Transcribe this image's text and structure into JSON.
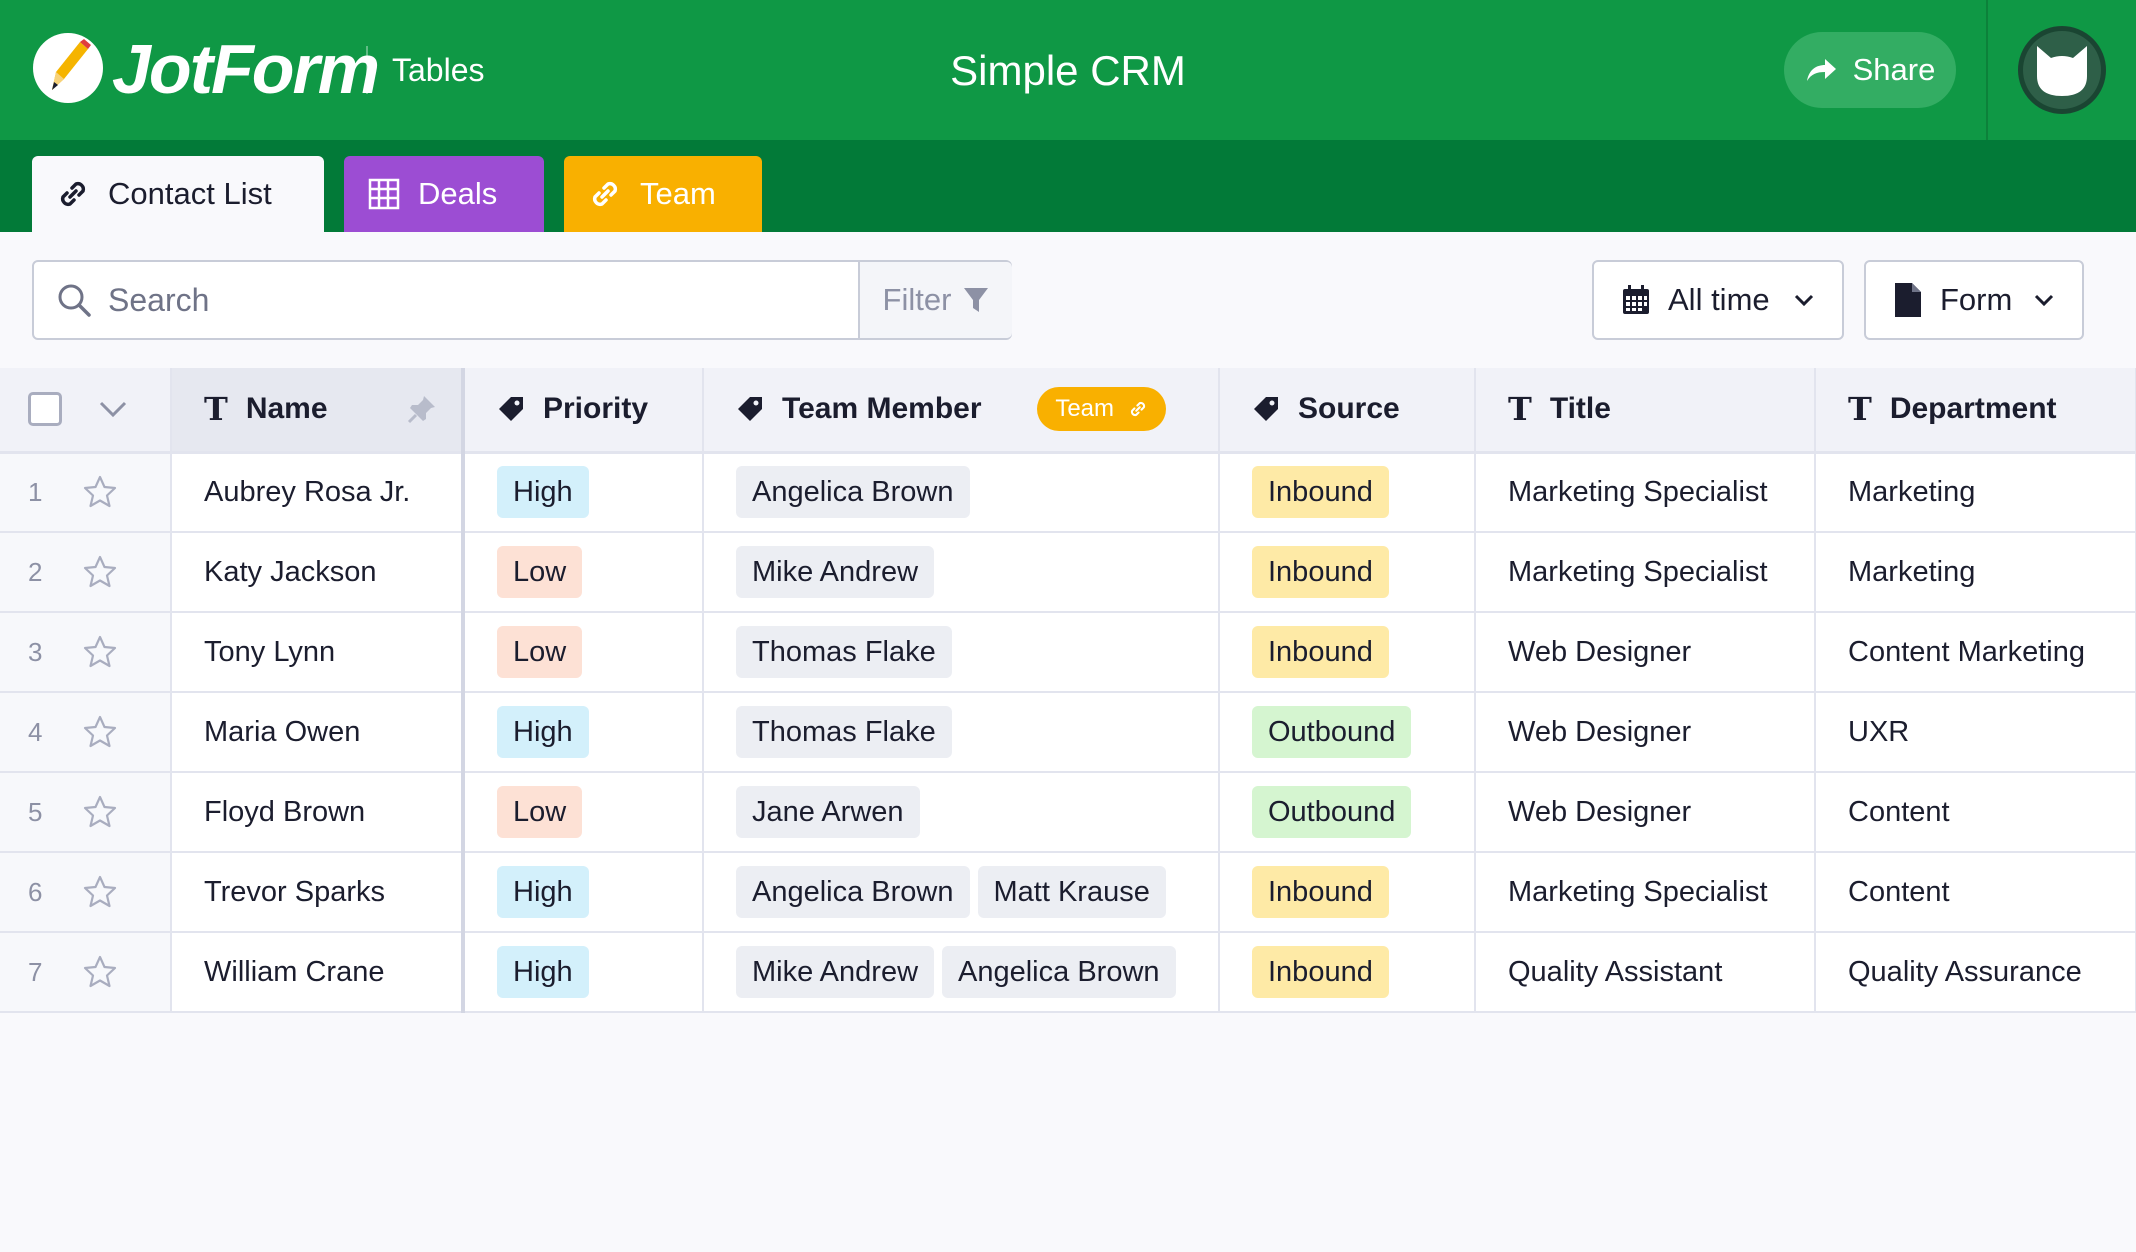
{
  "header": {
    "brand": "JotForm",
    "product": "Tables",
    "title": "Simple CRM",
    "share_label": "Share"
  },
  "tabs": [
    {
      "label": "Contact List",
      "icon": "link-icon",
      "active": true
    },
    {
      "label": "Deals",
      "icon": "grid-icon",
      "color": "#9c4dd3"
    },
    {
      "label": "Team",
      "icon": "link-icon",
      "color": "#f9b000"
    }
  ],
  "toolbar": {
    "search_placeholder": "Search",
    "filter_label": "Filter",
    "time_label": "All time",
    "form_label": "Form"
  },
  "columns": {
    "name": "Name",
    "priority": "Priority",
    "team_member": "Team Member",
    "team_badge": "Team",
    "source": "Source",
    "title": "Title",
    "department": "Department"
  },
  "rows": [
    {
      "id": "1",
      "name": "Aubrey Rosa Jr.",
      "priority": "High",
      "members": [
        "Angelica Brown"
      ],
      "source": "Inbound",
      "title": "Marketing Specialist",
      "department": "Marketing"
    },
    {
      "id": "2",
      "name": "Katy Jackson",
      "priority": "Low",
      "members": [
        "Mike Andrew"
      ],
      "source": "Inbound",
      "title": "Marketing Specialist",
      "department": "Marketing"
    },
    {
      "id": "3",
      "name": "Tony Lynn",
      "priority": "Low",
      "members": [
        "Thomas Flake"
      ],
      "source": "Inbound",
      "title": "Web Designer",
      "department": "Content Marketing"
    },
    {
      "id": "4",
      "name": "Maria Owen",
      "priority": "High",
      "members": [
        "Thomas Flake"
      ],
      "source": "Outbound",
      "title": "Web Designer",
      "department": "UXR"
    },
    {
      "id": "5",
      "name": "Floyd Brown",
      "priority": "Low",
      "members": [
        "Jane Arwen"
      ],
      "source": "Outbound",
      "title": "Web Designer",
      "department": "Content"
    },
    {
      "id": "6",
      "name": "Trevor Sparks",
      "priority": "High",
      "members": [
        "Angelica Brown",
        "Matt Krause"
      ],
      "source": "Inbound",
      "title": "Marketing Specialist",
      "department": "Content"
    },
    {
      "id": "7",
      "name": "William Crane",
      "priority": "High",
      "members": [
        "Mike Andrew",
        "Angelica Brown"
      ],
      "source": "Inbound",
      "title": "Quality Assistant",
      "department": "Quality Assurance"
    }
  ],
  "colors": {
    "header_green": "#0f9845",
    "tabbar_green": "#027a38",
    "deals_purple": "#9c4dd3",
    "team_orange": "#f9b000",
    "priority_high": "#d3f0fb",
    "priority_low": "#fde1d5",
    "source_inbound": "#feeaa6",
    "source_outbound": "#d5f5d0"
  }
}
